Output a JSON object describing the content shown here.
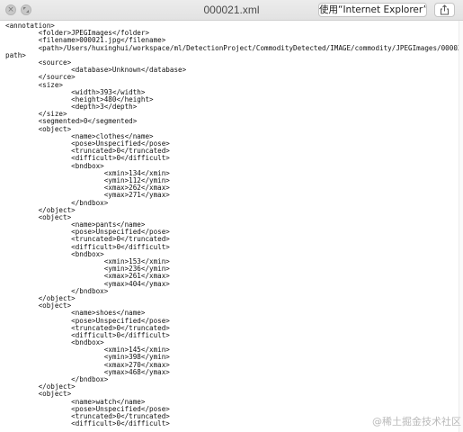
{
  "window": {
    "title": "000021.xml",
    "close_glyph": "×",
    "open_with_label": "使用“Internet Explorer”打开",
    "share_icon": "share-icon",
    "expand_icon": "expand-icon"
  },
  "document": {
    "lines": [
      "<annotation>",
      "\t<folder>JPEGImages</folder>",
      "\t<filename>000021.jpg</filename>",
      "\t<path>/Users/huxinghui/workspace/ml/DetectionProject/CommodityDetected/IMAGE/commodity/JPEGImages/000021.jpg</",
      "path>",
      "\t<source>",
      "\t\t<database>Unknown</database>",
      "\t</source>",
      "\t<size>",
      "\t\t<width>393</width>",
      "\t\t<height>480</height>",
      "\t\t<depth>3</depth>",
      "\t</size>",
      "\t<segmented>0</segmented>",
      "\t<object>",
      "\t\t<name>clothes</name>",
      "\t\t<pose>Unspecified</pose>",
      "\t\t<truncated>0</truncated>",
      "\t\t<difficult>0</difficult>",
      "\t\t<bndbox>",
      "\t\t\t<xmin>134</xmin>",
      "\t\t\t<ymin>112</ymin>",
      "\t\t\t<xmax>262</xmax>",
      "\t\t\t<ymax>271</ymax>",
      "\t\t</bndbox>",
      "\t</object>",
      "\t<object>",
      "\t\t<name>pants</name>",
      "\t\t<pose>Unspecified</pose>",
      "\t\t<truncated>0</truncated>",
      "\t\t<difficult>0</difficult>",
      "\t\t<bndbox>",
      "\t\t\t<xmin>153</xmin>",
      "\t\t\t<ymin>236</ymin>",
      "\t\t\t<xmax>261</xmax>",
      "\t\t\t<ymax>404</ymax>",
      "\t\t</bndbox>",
      "\t</object>",
      "\t<object>",
      "\t\t<name>shoes</name>",
      "\t\t<pose>Unspecified</pose>",
      "\t\t<truncated>0</truncated>",
      "\t\t<difficult>0</difficult>",
      "\t\t<bndbox>",
      "\t\t\t<xmin>145</xmin>",
      "\t\t\t<ymin>398</ymin>",
      "\t\t\t<xmax>270</xmax>",
      "\t\t\t<ymax>468</ymax>",
      "\t\t</bndbox>",
      "\t</object>",
      "\t<object>",
      "\t\t<name>watch</name>",
      "\t\t<pose>Unspecified</pose>",
      "\t\t<truncated>0</truncated>",
      "\t\t<difficult>0</difficult>"
    ]
  },
  "watermark": "@稀土掘金技术社区"
}
